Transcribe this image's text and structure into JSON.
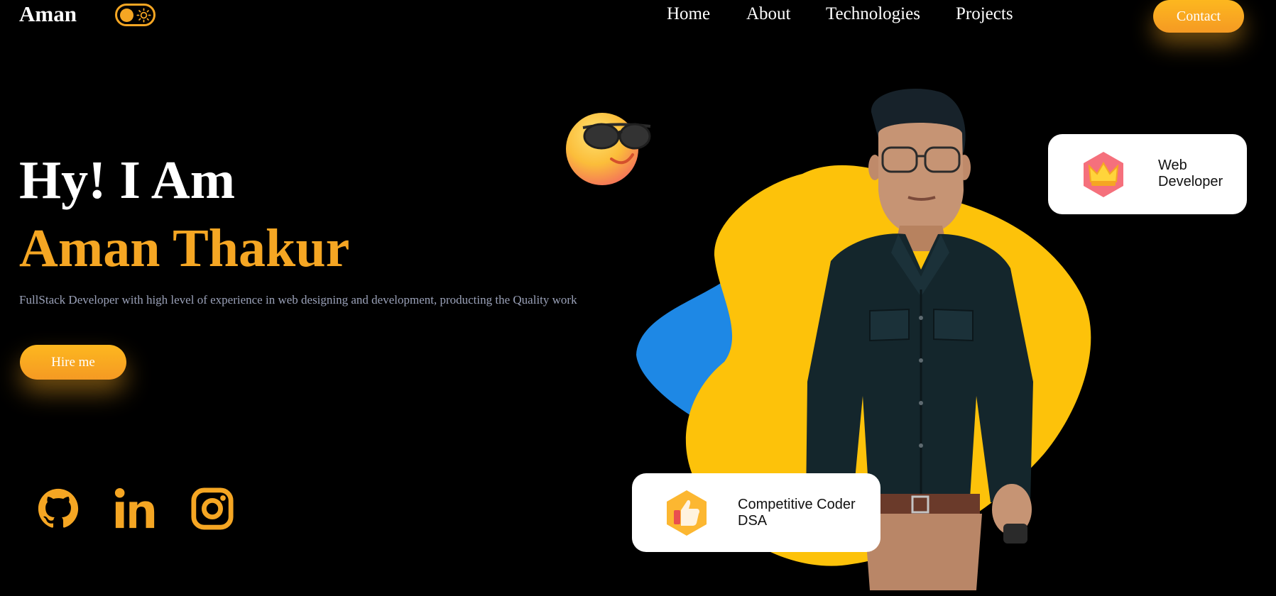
{
  "brand": "Aman",
  "nav": {
    "items": [
      "Home",
      "About",
      "Technologies",
      "Projects"
    ],
    "contact_label": "Contact"
  },
  "hero": {
    "greeting": "Hy! I Am",
    "name": "Aman Thakur",
    "description": "FullStack Developer with high level of experience in web designing and development, producting the Quality work",
    "hire_label": "Hire me"
  },
  "cards": {
    "web": {
      "line1": "Web",
      "line2": "Developer"
    },
    "coder": {
      "line1": "Competitive Coder",
      "line2": "DSA"
    }
  },
  "social": [
    "github-icon",
    "linkedin-icon",
    "instagram-icon"
  ],
  "colors": {
    "accent": "#f5a623",
    "background": "#000000",
    "blob_yellow": "#fdc20a",
    "blob_blue": "#1e88e5",
    "muted_text": "#9aa1b8"
  }
}
